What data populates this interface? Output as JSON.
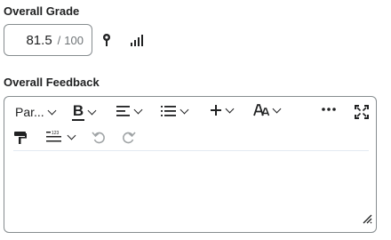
{
  "grade": {
    "label": "Overall Grade",
    "score": "81.5",
    "separator": "/",
    "max": "100"
  },
  "feedback": {
    "label": "Overall Feedback",
    "toolbar": {
      "paragraph_label": "Par...",
      "bold_label": "B"
    },
    "body_text": ""
  },
  "icons": {
    "pin": "pin-icon",
    "stats": "signal-bars-icon",
    "bold": "bold-icon",
    "align": "align-left-icon",
    "list": "bullet-list-icon",
    "insert": "plus-icon",
    "font": "font-size-icon",
    "more": "more-icon",
    "fullscreen": "fullscreen-icon",
    "format_painter": "format-painter-icon",
    "line_height": "line-height-icon",
    "undo": "undo-icon",
    "redo": "redo-icon",
    "resize": "resize-handle-icon"
  },
  "colors": {
    "text": "#202122",
    "border": "#868c8f",
    "muted": "#6e7376",
    "disabled": "#a0a4a6"
  }
}
